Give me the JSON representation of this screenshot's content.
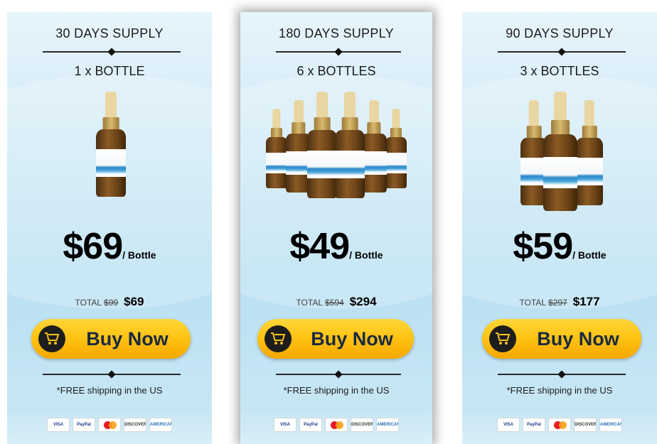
{
  "plans": [
    {
      "supply": "30 DAYS SUPPLY",
      "bottles": "1 x BOTTLE",
      "price": "$69",
      "per": "/ Bottle",
      "total_label": "TOTAL",
      "total_old": "$99",
      "total_new": "$69",
      "button": "Buy Now",
      "shipping": "*FREE shipping in the US"
    },
    {
      "supply": "180 DAYS SUPPLY",
      "bottles": "6 x BOTTLES",
      "price": "$49",
      "per": "/ Bottle",
      "total_label": "TOTAL",
      "total_old": "$594",
      "total_new": "$294",
      "button": "Buy Now",
      "shipping": "*FREE shipping in the US"
    },
    {
      "supply": "90 DAYS SUPPLY",
      "bottles": "3 x BOTTLES",
      "price": "$59",
      "per": "/ Bottle",
      "total_label": "TOTAL",
      "total_old": "$297",
      "total_new": "$177",
      "button": "Buy Now",
      "shipping": "*FREE shipping in the US"
    }
  ],
  "payment_cards": [
    "VISA",
    "PayPal",
    "mastercard-icon",
    "DISCOVER",
    "AMERICAN EXPRESS"
  ],
  "colors": {
    "button_yellow": "#ffc414",
    "button_text": "#1a2a40",
    "card_bg": "#d3ebf7"
  }
}
